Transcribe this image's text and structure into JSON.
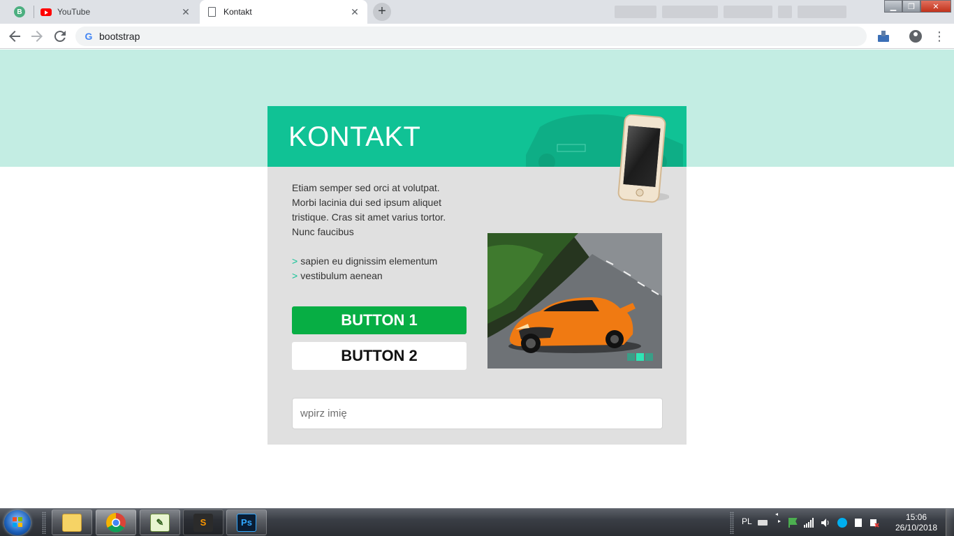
{
  "browser": {
    "tabs": [
      {
        "label": "",
        "pinned": true,
        "icon": "bootstrap-favicon"
      },
      {
        "label": "YouTube",
        "icon": "youtube-icon"
      },
      {
        "label": "Kontakt",
        "icon": "page-icon",
        "active": true
      }
    ],
    "address": "bootstrap"
  },
  "page": {
    "title": "KONTAKT",
    "paragraph": "Etiam semper sed orci at volutpat. Morbi lacinia dui sed ipsum aliquet tristique. Cras sit amet varius tortor. Nunc faucibus",
    "bullet_marker": ">",
    "bullets": [
      "sapien eu dignissim elementum",
      "vestibulum aenean"
    ],
    "button1": "BUTTON 1",
    "button2": "BUTTON 2",
    "name_placeholder": "wpirz imię",
    "slider_dots": 3,
    "slider_active": 2,
    "colors": {
      "band": "#c3ede3",
      "header": "#10c295",
      "card": "#e0e0e0",
      "button1": "#07ae44"
    }
  },
  "taskbar": {
    "language": "PL",
    "time": "15:06",
    "date": "26/10/2018",
    "apps": [
      "file-explorer-icon",
      "chrome-icon",
      "notepad-icon",
      "sublime-text-icon",
      "photoshop-icon"
    ],
    "photoshop_label": "Ps",
    "sublime_label": "S"
  }
}
